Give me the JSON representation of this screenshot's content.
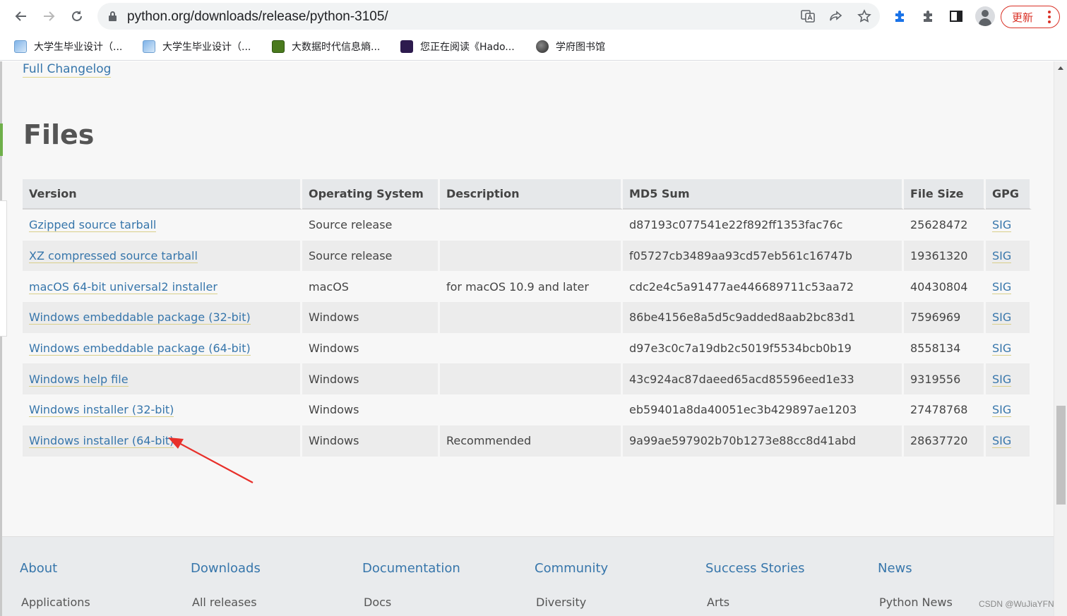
{
  "browser": {
    "url": "python.org/downloads/release/python-3105/",
    "update_label": "更新",
    "bookmarks": [
      {
        "label": "大学生毕业设计（..."
      },
      {
        "label": "大学生毕业设计（..."
      },
      {
        "label": "大数据时代信息熵..."
      },
      {
        "label": "您正在阅读《Hado..."
      },
      {
        "label": "学府图书馆"
      }
    ]
  },
  "page": {
    "changelog_link": "Full Changelog",
    "files_heading": "Files",
    "table": {
      "headers": [
        "Version",
        "Operating System",
        "Description",
        "MD5 Sum",
        "File Size",
        "GPG"
      ],
      "rows": [
        {
          "version": "Gzipped source tarball",
          "os": "Source release",
          "description": "",
          "md5": "d87193c077541e22f892ff1353fac76c",
          "size": "25628472",
          "gpg": "SIG"
        },
        {
          "version": "XZ compressed source tarball",
          "os": "Source release",
          "description": "",
          "md5": "f05727cb3489aa93cd57eb561c16747b",
          "size": "19361320",
          "gpg": "SIG"
        },
        {
          "version": "macOS 64-bit universal2 installer",
          "os": "macOS",
          "description": "for macOS 10.9 and later",
          "md5": "cdc2e4c5a91477ae446689711c53aa72",
          "size": "40430804",
          "gpg": "SIG"
        },
        {
          "version": "Windows embeddable package (32-bit)",
          "os": "Windows",
          "description": "",
          "md5": "86be4156e8a5d5c9added8aab2bc83d1",
          "size": "7596969",
          "gpg": "SIG"
        },
        {
          "version": "Windows embeddable package (64-bit)",
          "os": "Windows",
          "description": "",
          "md5": "d97e3c0c7a19db2c5019f5534bcb0b19",
          "size": "8558134",
          "gpg": "SIG"
        },
        {
          "version": "Windows help file",
          "os": "Windows",
          "description": "",
          "md5": "43c924ac87daeed65acd85596eed1e33",
          "size": "9319556",
          "gpg": "SIG"
        },
        {
          "version": "Windows installer (32-bit)",
          "os": "Windows",
          "description": "",
          "md5": "eb59401a8da40051ec3b429897ae1203",
          "size": "27478768",
          "gpg": "SIG"
        },
        {
          "version": "Windows installer (64-bit)",
          "os": "Windows",
          "description": "Recommended",
          "md5": "9a99ae597902b70b1273e88cc8d41abd",
          "size": "28637720",
          "gpg": "SIG"
        }
      ]
    }
  },
  "footer": {
    "columns": [
      {
        "heading": "About",
        "item": "Applications"
      },
      {
        "heading": "Downloads",
        "item": "All releases"
      },
      {
        "heading": "Documentation",
        "item": "Docs"
      },
      {
        "heading": "Community",
        "item": "Diversity"
      },
      {
        "heading": "Success Stories",
        "item": "Arts"
      },
      {
        "heading": "News",
        "item": "Python News"
      }
    ]
  },
  "watermark": "CSDN @WuJiaYFN",
  "colors": {
    "link": "#3776ab",
    "update_red": "#d93025",
    "annotation_arrow": "#e8302a"
  }
}
